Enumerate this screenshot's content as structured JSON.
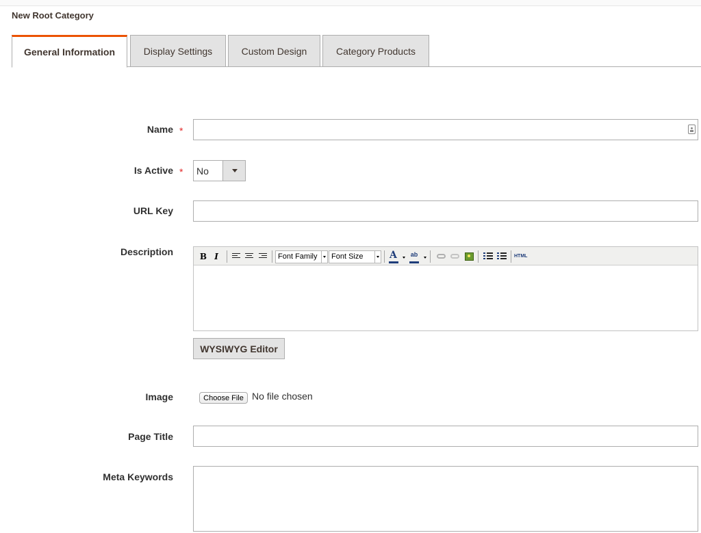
{
  "header": {
    "title": "New Root Category"
  },
  "tabs": [
    {
      "label": "General Information",
      "active": true
    },
    {
      "label": "Display Settings",
      "active": false
    },
    {
      "label": "Custom Design",
      "active": false
    },
    {
      "label": "Category Products",
      "active": false
    }
  ],
  "form": {
    "required_mark": "*",
    "name": {
      "label": "Name",
      "value": "",
      "icon": "contact-card-icon"
    },
    "is_active": {
      "label": "Is Active",
      "value": "No"
    },
    "url_key": {
      "label": "URL Key",
      "value": ""
    },
    "description": {
      "label": "Description",
      "toolbar": {
        "bold": "B",
        "italic": "I",
        "font_family": "Font Family",
        "font_size": "Font Size",
        "text_color": "A",
        "highlight": "ab",
        "html": "HTML"
      },
      "wysiwyg_button": "WYSIWYG Editor"
    },
    "image": {
      "label": "Image",
      "choose_button": "Choose File",
      "status": "No file chosen"
    },
    "page_title": {
      "label": "Page Title",
      "value": ""
    },
    "meta_keywords": {
      "label": "Meta Keywords",
      "value": ""
    }
  },
  "colors": {
    "accent": "#eb5202",
    "required": "#e22626",
    "tab_bg": "#e3e3e3",
    "border": "#adadad"
  }
}
